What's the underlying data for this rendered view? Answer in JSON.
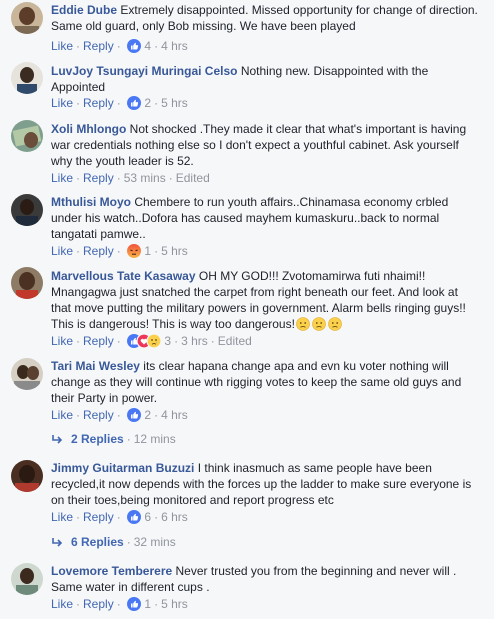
{
  "comments": [
    {
      "author": "Eddie Dube",
      "text": "Extremely disappointed. Missed opportunity for change of direction. Same old guard, only Bob missing. We have been played",
      "like": "Like",
      "reply": "Reply",
      "reaction_count": "4",
      "time": "4 hrs",
      "reactions": [
        "like"
      ]
    },
    {
      "author": "LuvJoy Tsungayi Muringai Celso",
      "text": "Nothing new. Disappointed with the Appointed",
      "like": "Like",
      "reply": "Reply",
      "reaction_count": "2",
      "time": "5 hrs",
      "reactions": [
        "like"
      ]
    },
    {
      "author": "Xoli Mhlongo",
      "text": "Not shocked .They made it clear that what's important is having war credentials nothing else so I don't expect a youthful cabinet. Ask yourself why the youth leader is 52.",
      "like": "Like",
      "reply": "Reply",
      "time": "53 mins",
      "edited": "Edited"
    },
    {
      "author": "Mthulisi Moyo",
      "text": "Chembere to run youth affairs..Chinamasa economy crbled under his watch..Dofora has caused mayhem kumaskuru..back to normal tangatati pamwe..",
      "like": "Like",
      "reply": "Reply",
      "reaction_count": "1",
      "time": "5 hrs",
      "reactions": [
        "angry"
      ]
    },
    {
      "author": "Marvellous Tate Kasaway",
      "text": "OH MY GOD!!! Zvotomamirwa futi nhaimi!! Mnangagwa just snatched the carpet from right beneath our feet. And look at that move putting the military powers in government. Alarm bells ringing guys!! This is dangerous! This is way too dangerous!",
      "emoji_suffix": [
        "worried-face-emoji",
        "worried-face-emoji",
        "worried-face-emoji"
      ],
      "like": "Like",
      "reply": "Reply",
      "reaction_count": "3",
      "time": "3 hrs",
      "edited": "Edited",
      "reactions": [
        "like",
        "love",
        "sad"
      ]
    },
    {
      "author": "Tari Mai Wesley",
      "text": "its clear hapana change apa and evn ku voter nothing will change as they will continue wth rigging votes to keep the same old guys and their Party in power.",
      "like": "Like",
      "reply": "Reply",
      "reaction_count": "2",
      "time": "4 hrs",
      "reactions": [
        "like"
      ],
      "replies_label": "2 Replies",
      "replies_time": "12 mins"
    },
    {
      "author": "Jimmy Guitarman Buzuzi",
      "text": "I think inasmuch as same people have been recycled,it now depends with the forces up the ladder to make sure everyone is on their toes,being monitored and report progress etc",
      "like": "Like",
      "reply": "Reply",
      "reaction_count": "6",
      "time": "6 hrs",
      "reactions": [
        "like"
      ],
      "replies_label": "6 Replies",
      "replies_time": "32 mins"
    },
    {
      "author": "Lovemore Temberere",
      "text": "Never trusted you from the beginning and never will . Same water in different cups .",
      "like": "Like",
      "reply": "Reply",
      "reaction_count": "1",
      "time": "5 hrs",
      "reactions": [
        "like"
      ]
    }
  ],
  "colors": {
    "link": "#385898",
    "action": "#4267b2",
    "meta": "#90949c",
    "like_badge": "#4a78f5",
    "love_badge": "#f0355a",
    "angry_badge": "#f7714c",
    "emoji_yellow": "#fbd14b"
  }
}
